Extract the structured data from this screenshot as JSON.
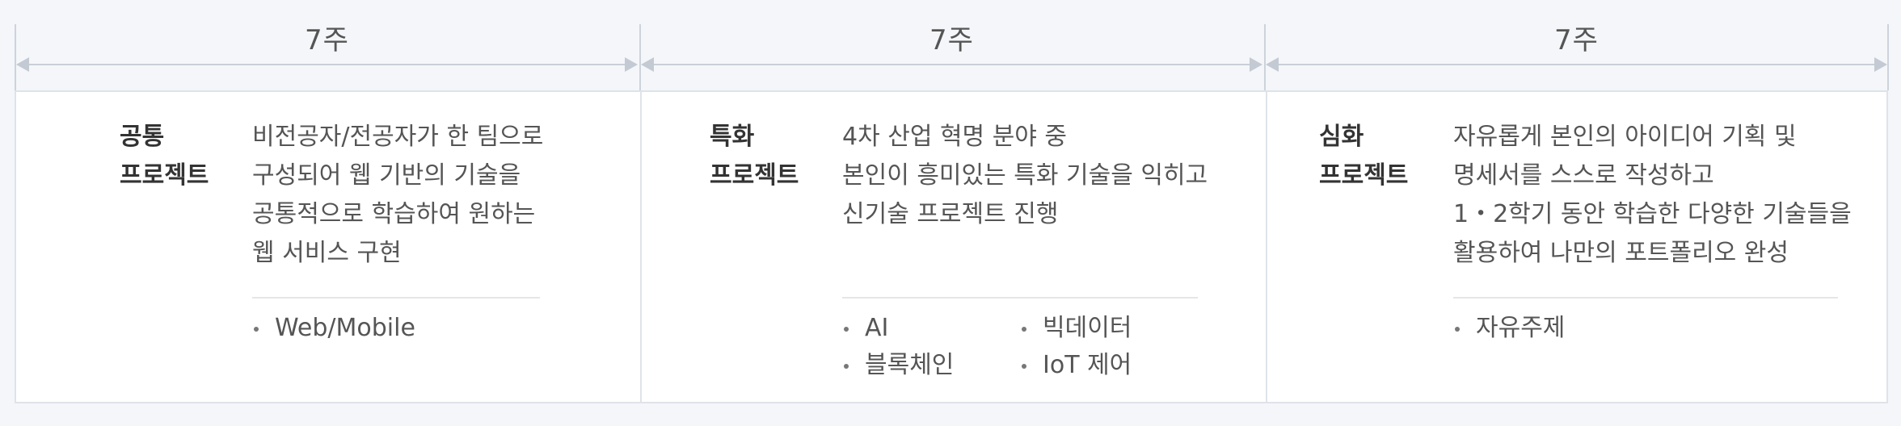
{
  "timeline": [
    {
      "label": "7주"
    },
    {
      "label": "7주"
    },
    {
      "label": "7주"
    }
  ],
  "cards": [
    {
      "title_line1": "공통",
      "title_line2": "프로젝트",
      "desc": [
        "비전공자/전공자가 한 팀으로",
        "구성되어 웹 기반의 기술을",
        "공통적으로 학습하여 원하는",
        "웹 서비스 구현"
      ],
      "tags": [
        "Web/Mobile"
      ]
    },
    {
      "title_line1": "특화",
      "title_line2": "프로젝트",
      "desc": [
        "4차 산업 혁명 분야 중",
        "본인이 흥미있는 특화 기술을 익히고",
        "신기술 프로젝트 진행"
      ],
      "tags": [
        "AI",
        "빅데이터",
        "블록체인",
        "IoT 제어"
      ]
    },
    {
      "title_line1": "심화",
      "title_line2": "프로젝트",
      "desc": [
        "자유롭게 본인의 아이디어 기획 및",
        "명세서를 스스로 작성하고",
        "1・2학기 동안 학습한 다양한 기술들을",
        "활용하여 나만의 포트폴리오 완성"
      ],
      "tags": [
        "자유주제"
      ]
    }
  ]
}
